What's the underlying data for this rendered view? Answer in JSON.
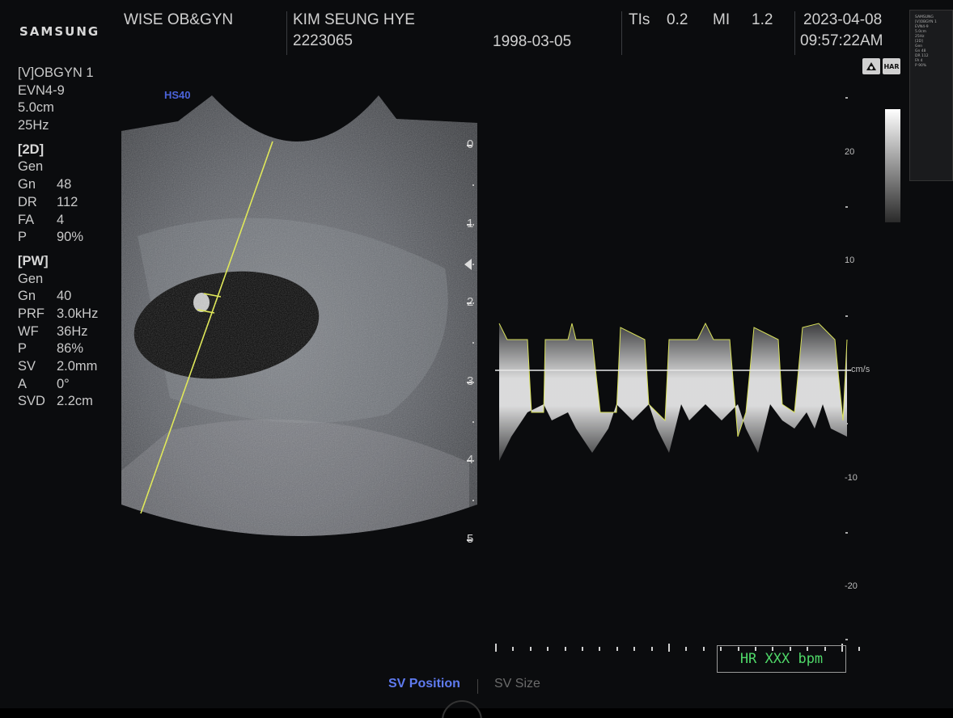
{
  "header": {
    "brand": "SAMSUNG",
    "hospital": "WISE OB&GYN",
    "patient_name": "KIM SEUNG HYE",
    "patient_id": "2223065",
    "birth_date": "1998-03-05",
    "tis_label": "TIs",
    "tis_value": "0.2",
    "mi_label": "MI",
    "mi_value": "1.2",
    "date": "2023-04-08",
    "time": "09:57:22AM"
  },
  "params": {
    "preset": "[V]OBGYN 1",
    "probe": "EVN4-9",
    "depth": "5.0cm",
    "frame_rate": "25Hz",
    "section_2d": {
      "title": "[2D]",
      "mode": "Gen",
      "rows": [
        {
          "k": "Gn",
          "v": "48"
        },
        {
          "k": "DR",
          "v": "112"
        },
        {
          "k": "FA",
          "v": "4"
        },
        {
          "k": "P",
          "v": "90%"
        }
      ]
    },
    "section_pw": {
      "title": "[PW]",
      "mode": "Gen",
      "rows": [
        {
          "k": "Gn",
          "v": "40"
        },
        {
          "k": "PRF",
          "v": "3.0kHz"
        },
        {
          "k": "WF",
          "v": "36Hz"
        },
        {
          "k": "P",
          "v": "86%"
        },
        {
          "k": "SV",
          "v": "2.0mm"
        },
        {
          "k": "A",
          "v": "0°"
        },
        {
          "k": "SVD",
          "v": "2.2cm"
        }
      ]
    }
  },
  "image": {
    "label": "HS40",
    "depth_ticks": [
      "0",
      "1",
      "2",
      "3",
      "4",
      "5"
    ]
  },
  "doppler": {
    "scale_labels": [
      "20",
      "10",
      "cm/s",
      "-10",
      "-20"
    ],
    "hr_label": "HR XXX bpm"
  },
  "icons": {
    "probe_icon": "probe-icon",
    "har_label": "HAR"
  },
  "softkeys": {
    "sv_position": "SV Position",
    "sv_size": "SV Size"
  },
  "colors": {
    "accent_blue": "#5f7bf0",
    "hr_green": "#4fd868",
    "cursor_yellow": "#e0e85a"
  }
}
